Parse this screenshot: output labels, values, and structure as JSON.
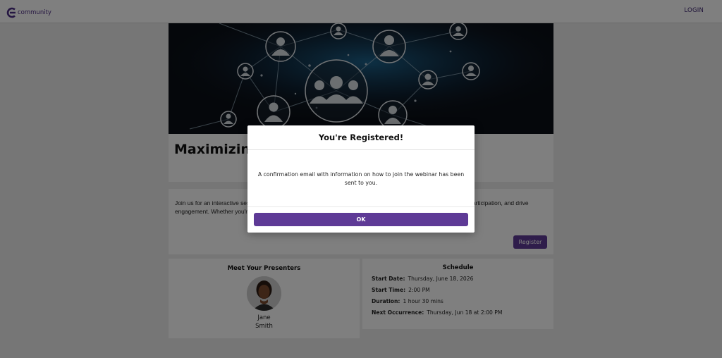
{
  "header": {
    "logo_text": "community",
    "login_label": "LOGIN"
  },
  "event": {
    "title": "Maximizing Your Association's Potential",
    "description": "Join us for an interactive session exploring the platform's key features that streamline operations, boost member participation, and drive engagement. Whether you're a staff member, you'll walk away with practical strategies.",
    "register_label": "Register"
  },
  "presenters": {
    "heading": "Meet Your Presenters",
    "items": [
      {
        "first_name": "Jane",
        "last_name": "Smith"
      }
    ]
  },
  "schedule": {
    "heading": "Schedule",
    "rows": [
      {
        "label": "Start Date:",
        "value": "Thursday, June 18, 2026"
      },
      {
        "label": "Start Time:",
        "value": "2:00 PM"
      },
      {
        "label": "Duration:",
        "value": "1 hour 30 mins"
      },
      {
        "label": "Next Occurrence:",
        "value": "Thursday, Jun 18 at 2:00 PM"
      }
    ]
  },
  "modal": {
    "title": "You're Registered!",
    "body": "A confirmation email with information on how to join the webinar has been sent to you.",
    "ok_label": "OK"
  },
  "colors": {
    "brand_purple": "#5e3a96",
    "overlay": "rgba(0,0,0,0.5)"
  }
}
